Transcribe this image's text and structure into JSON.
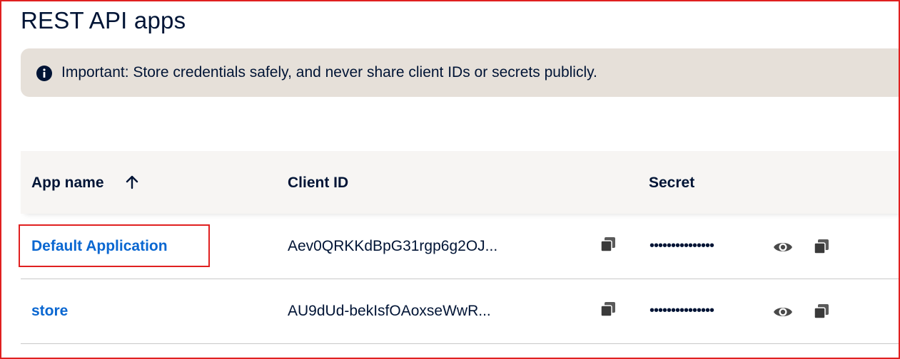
{
  "page": {
    "title": "REST API apps"
  },
  "notice": {
    "text": "Important: Store credentials safely, and never share client IDs or secrets publicly."
  },
  "table": {
    "headers": {
      "app_name": "App name",
      "client_id": "Client ID",
      "secret": "Secret"
    },
    "sort": {
      "column": "App name",
      "direction": "ascending"
    },
    "rows": [
      {
        "app_name": "Default Application",
        "client_id": "Aev0QRKKdBpG31rgp6g2OJ...",
        "secret_mask": "•••••••••••••••"
      },
      {
        "app_name": "store",
        "client_id": "AU9dUd-bekIsfOAoxseWwR...",
        "secret_mask": "•••••••••••••••"
      }
    ]
  },
  "colors": {
    "link": "#0a67d1",
    "text": "#001435",
    "notice_bg": "#e6e0d9",
    "header_bg": "#f7f5f3",
    "highlight": "#e02020"
  }
}
